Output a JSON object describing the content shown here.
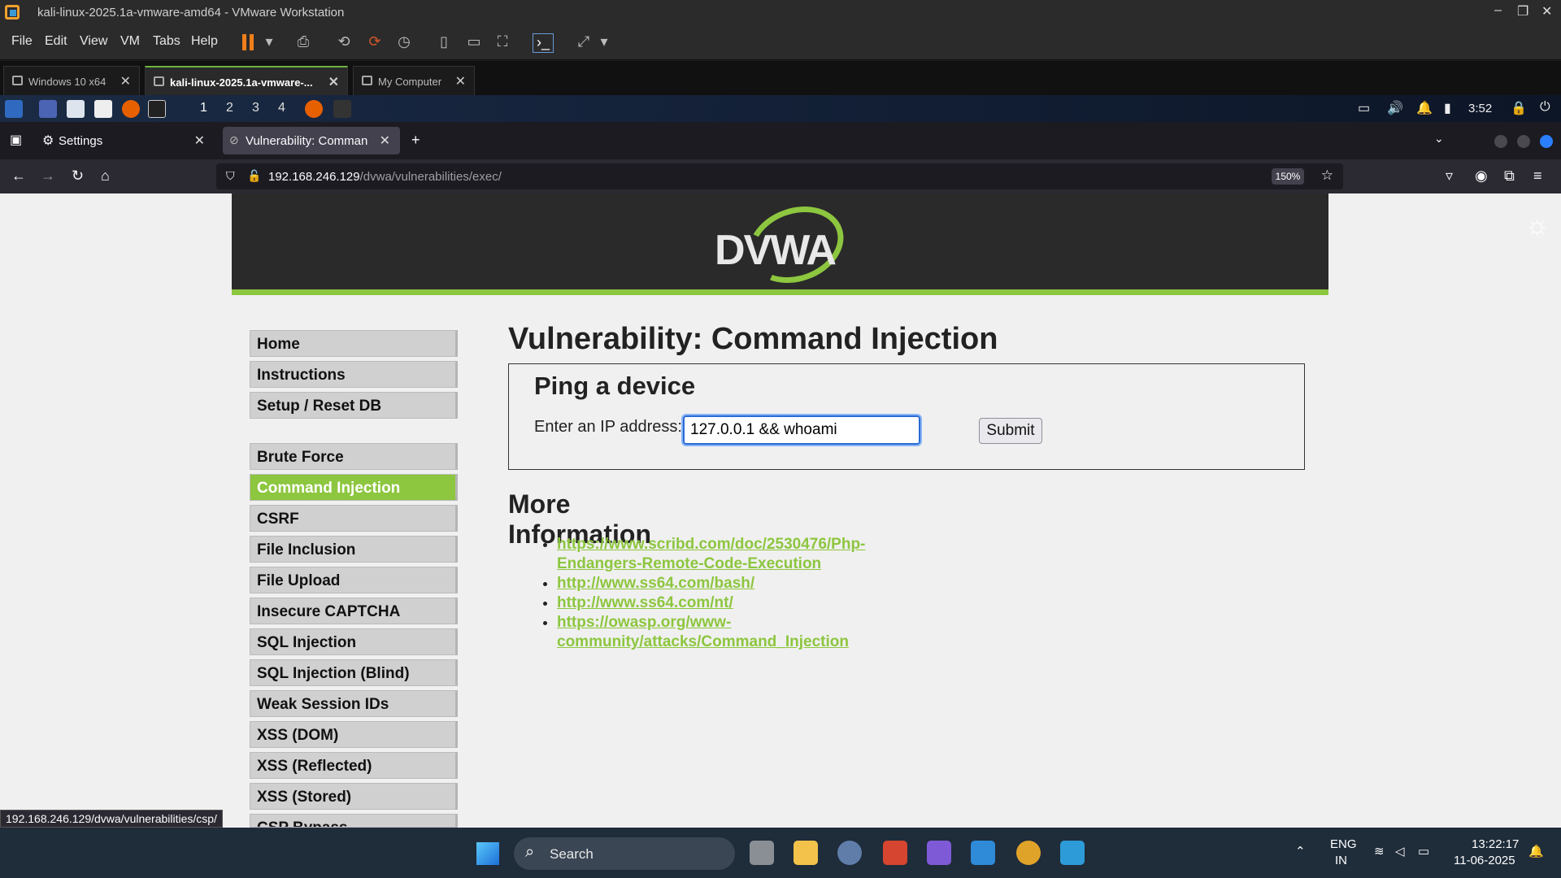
{
  "vmware": {
    "title": "kali-linux-2025.1a-vmware-amd64 - VMware Workstation",
    "menu": [
      "File",
      "Edit",
      "View",
      "VM",
      "Tabs",
      "Help"
    ],
    "tabs": [
      {
        "label": "Windows 10 x64"
      },
      {
        "label": "kali-linux-2025.1a-vmware-..."
      },
      {
        "label": "My Computer"
      }
    ]
  },
  "kali_panel": {
    "workspaces": [
      "1",
      "2",
      "3",
      "4"
    ],
    "clock": "3:52"
  },
  "browser": {
    "tabs": [
      {
        "label": "Settings"
      },
      {
        "label": "Vulnerability: Command I"
      }
    ],
    "url_host": "192.168.246.129",
    "url_path": "/dvwa/vulnerabilities/exec/",
    "zoom": "150%",
    "status_url": "192.168.246.129/dvwa/vulnerabilities/csp/"
  },
  "dvwa": {
    "logo": "DVWA",
    "menu_top": [
      "Home",
      "Instructions",
      "Setup / Reset DB"
    ],
    "menu_vulns": [
      "Brute Force",
      "Command Injection",
      "CSRF",
      "File Inclusion",
      "File Upload",
      "Insecure CAPTCHA",
      "SQL Injection",
      "SQL Injection (Blind)",
      "Weak Session IDs",
      "XSS (DOM)",
      "XSS (Reflected)",
      "XSS (Stored)",
      "CSP Bypass"
    ],
    "selected": "Command Injection",
    "page_title": "Vulnerability: Command Injection",
    "form_title": "Ping a device",
    "ip_label": "Enter an IP address:",
    "ip_value": "127.0.0.1 && whoami",
    "submit": "Submit",
    "more_info": "More Information",
    "links": [
      "https://www.scribd.com/doc/2530476/Php-Endangers-Remote-Code-Execution",
      "http://www.ss64.com/bash/",
      "http://www.ss64.com/nt/",
      "https://owasp.org/www-community/attacks/Command_Injection"
    ]
  },
  "taskbar": {
    "search": "Search",
    "lang": "ENG",
    "region": "IN",
    "time": "13:22:17",
    "date": "11-06-2025"
  },
  "colors": {
    "dvwa_green": "#8dc63f",
    "header": "#2a2a2a"
  }
}
